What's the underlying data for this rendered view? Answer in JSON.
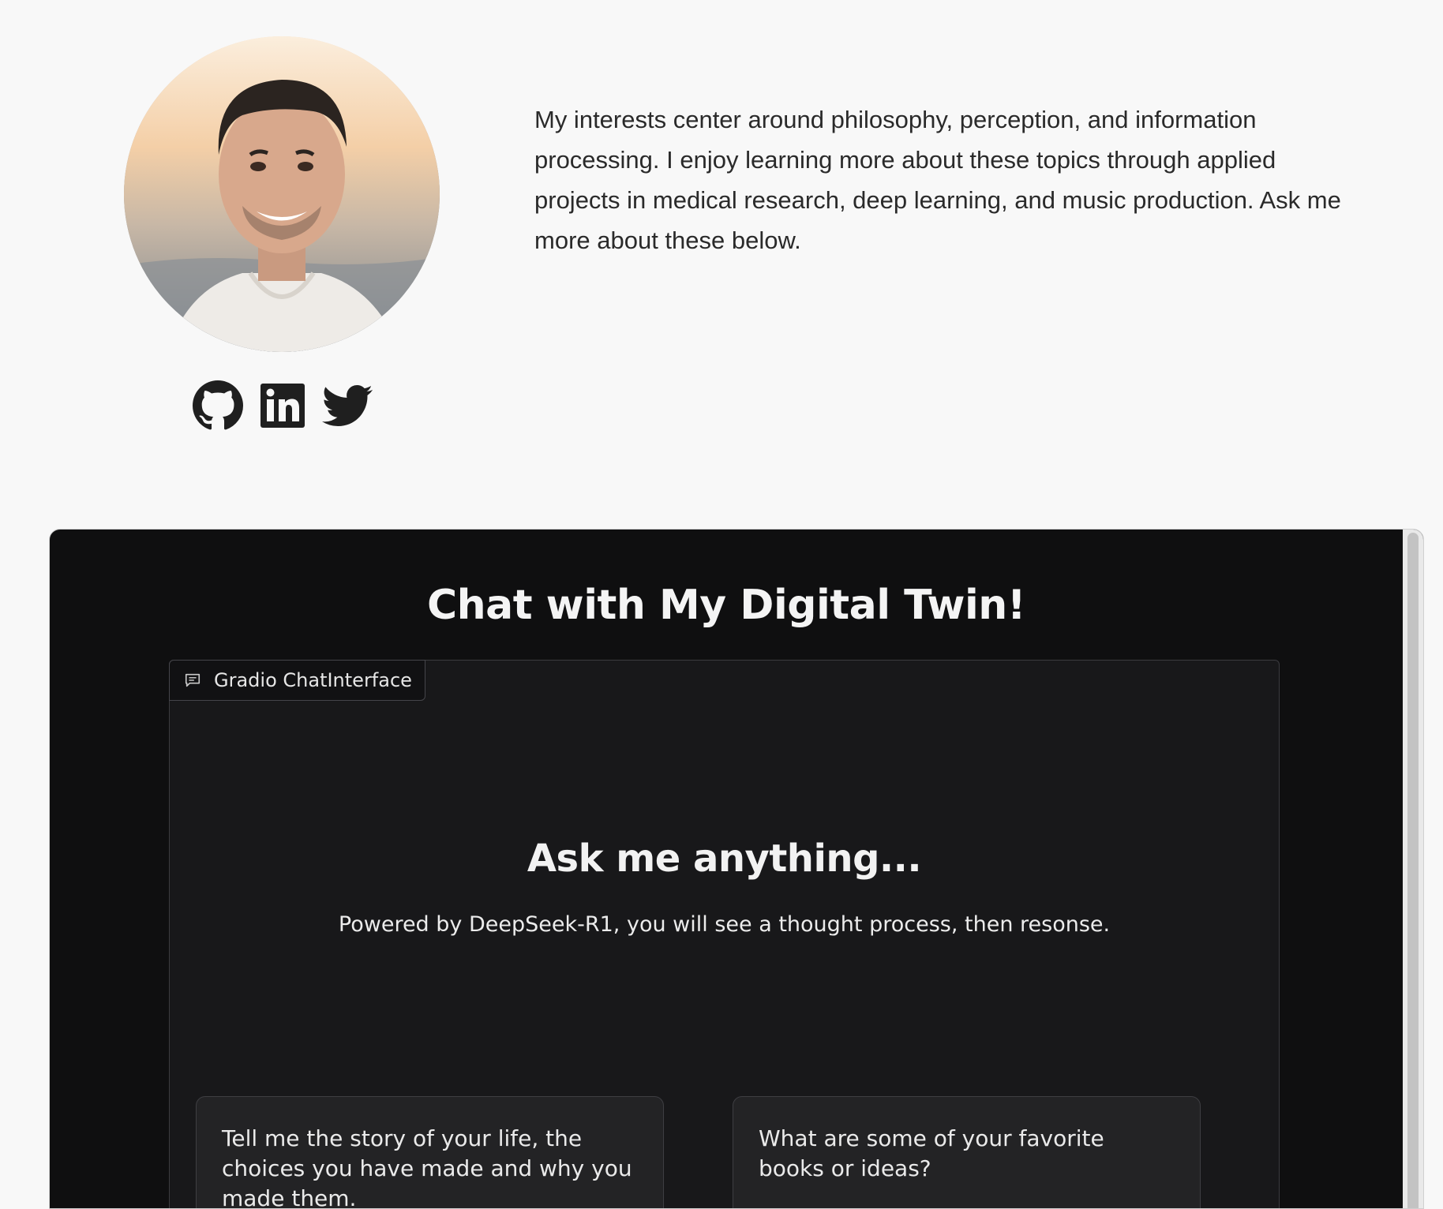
{
  "profile": {
    "bio": "My interests center around philosophy, perception, and information processing. I enjoy learning more about these topics through applied projects in medical research, deep learning, and music production. Ask me more about these below.",
    "socials": [
      {
        "icon": "github-icon"
      },
      {
        "icon": "linkedin-icon"
      },
      {
        "icon": "twitter-icon"
      }
    ]
  },
  "app": {
    "title": "Chat with My Digital Twin!",
    "panel_label": "Gradio ChatInterface",
    "placeholder_title": "Ask me anything...",
    "placeholder_subtitle": "Powered by DeepSeek-R1, you will see a thought process, then resonse.",
    "examples": [
      "Tell me the story of your life, the choices you have made and why you made them.",
      "What are some of your favorite books or ideas?"
    ]
  },
  "colors": {
    "page_background": "#f8f8f8",
    "app_background": "#0f0f10",
    "panel_background": "#18181a",
    "example_background": "#232325",
    "icon_color": "#1f1f1f"
  }
}
